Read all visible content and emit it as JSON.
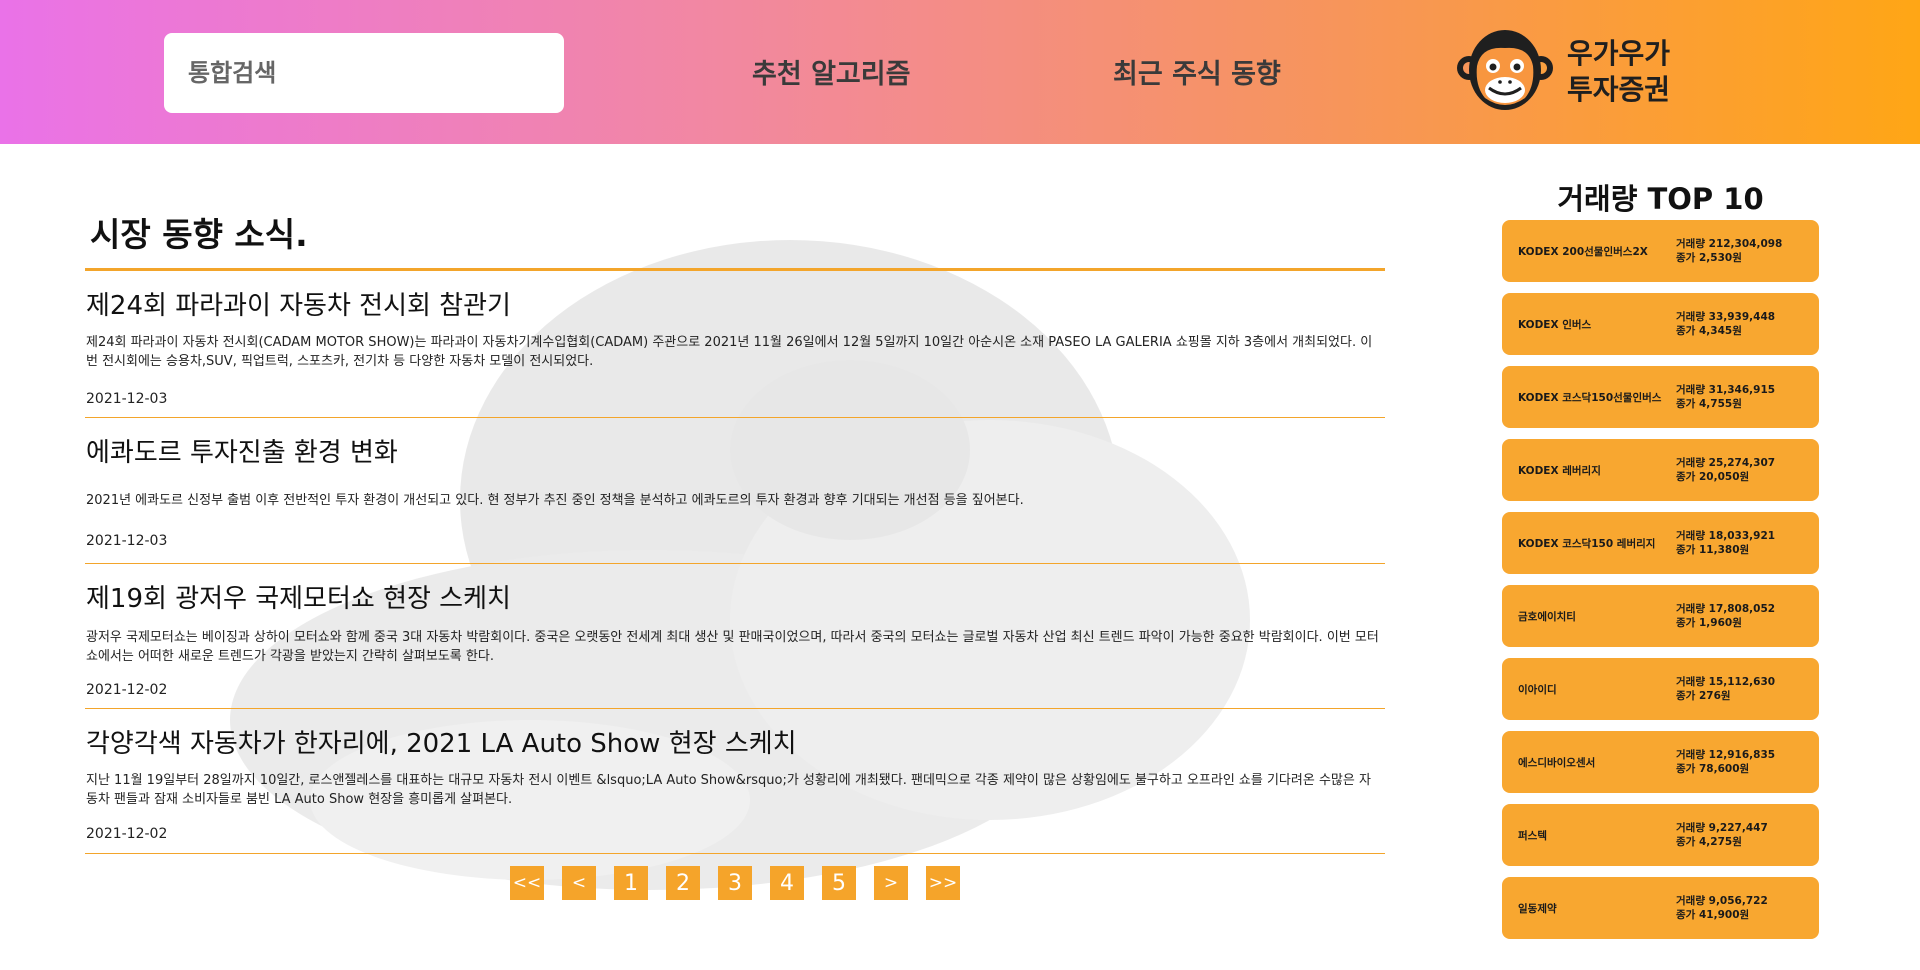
{
  "header": {
    "search_placeholder": "통합검색",
    "nav_recommend": "추천 알고리즘",
    "nav_trend": "최근 주식 동향",
    "logo_line1": "우가우가",
    "logo_line2": "투자증권"
  },
  "main": {
    "section_title": "시장 동향 소식.",
    "articles": [
      {
        "title": "제24회 파라과이 자동차 전시회 참관기",
        "summary": "제24회 파라과이 자동차 전시회(CADAM MOTOR SHOW)는 파라과이 자동차기계수입협회(CADAM) 주관으로 2021년 11월 26일에서 12월 5일까지 10일간 아순시온 소재 PASEO LA GALERIA 쇼핑몰 지하 3층에서 개최되었다. 이번 전시회에는 승용차,SUV, 픽업트럭, 스포츠카, 전기차 등 다양한 자동차 모델이 전시되었다.",
        "date": "2021-12-03"
      },
      {
        "title": "에콰도르 투자진출 환경 변화",
        "summary": "2021년 에콰도르 신정부 출범 이후 전반적인 투자 환경이 개선되고 있다. 현 정부가 추진 중인 정책을 분석하고 에콰도르의 투자 환경과 향후 기대되는 개선점 등을 짚어본다.",
        "date": "2021-12-03"
      },
      {
        "title": "제19회 광저우 국제모터쇼 현장 스케치",
        "summary": "광저우 국제모터쇼는 베이징과 상하이 모터쇼와 함께 중국 3대 자동차 박람회이다. 중국은 오랫동안 전세계 최대 생산 및 판매국이었으며, 따라서 중국의 모터쇼는 글로벌 자동차 산업 최신 트렌드 파악이 가능한 중요한 박람회이다. 이번 모터쇼에서는 어떠한 새로운 트렌드가 각광을 받았는지 간략히 살펴보도록 한다.",
        "date": "2021-12-02"
      },
      {
        "title": "각양각색 자동차가 한자리에, 2021 LA Auto Show 현장 스케치",
        "summary": "지난 11월 19일부터 28일까지 10일간, 로스앤젤레스를 대표하는 대규모 자동차 전시 이벤트 &lsquo;LA Auto Show&rsquo;가 성황리에 개최됐다. 팬데믹으로 각종 제약이 많은 상황임에도 불구하고 오프라인 쇼를 기다려온 수많은 자동차 팬들과 잠재 소비자들로 붐빈 LA Auto Show 현장을 흥미롭게 살펴본다.",
        "date": "2021-12-02"
      }
    ],
    "pagination": [
      "<<",
      "<",
      "1",
      "2",
      "3",
      "4",
      "5",
      ">",
      ">>"
    ]
  },
  "sidebar": {
    "title": "거래량 TOP 10",
    "stocks": [
      {
        "name": "KODEX 200선물인버스2X",
        "volume": "거래량 212,304,098",
        "close": "종가 2,530원"
      },
      {
        "name": "KODEX 인버스",
        "volume": "거래량 33,939,448",
        "close": "종가 4,345원"
      },
      {
        "name": "KODEX 코스닥150선물인버스",
        "volume": "거래량 31,346,915",
        "close": "종가 4,755원"
      },
      {
        "name": "KODEX 레버리지",
        "volume": "거래량 25,274,307",
        "close": "종가 20,050원"
      },
      {
        "name": "KODEX 코스닥150 레버리지",
        "volume": "거래량 18,033,921",
        "close": "종가 11,380원"
      },
      {
        "name": "금호에이치티",
        "volume": "거래량 17,808,052",
        "close": "종가 1,960원"
      },
      {
        "name": "이아이디",
        "volume": "거래량 15,112,630",
        "close": "종가 276원"
      },
      {
        "name": "에스디바이오센서",
        "volume": "거래량 12,916,835",
        "close": "종가 78,600원"
      },
      {
        "name": "퍼스텍",
        "volume": "거래량 9,227,447",
        "close": "종가 4,275원"
      },
      {
        "name": "일동제약",
        "volume": "거래량 9,056,722",
        "close": "종가 41,900원"
      }
    ]
  },
  "colors": {
    "accent": "#f5a42a",
    "header_start": "#ea72e8",
    "header_end": "#ffa615"
  }
}
